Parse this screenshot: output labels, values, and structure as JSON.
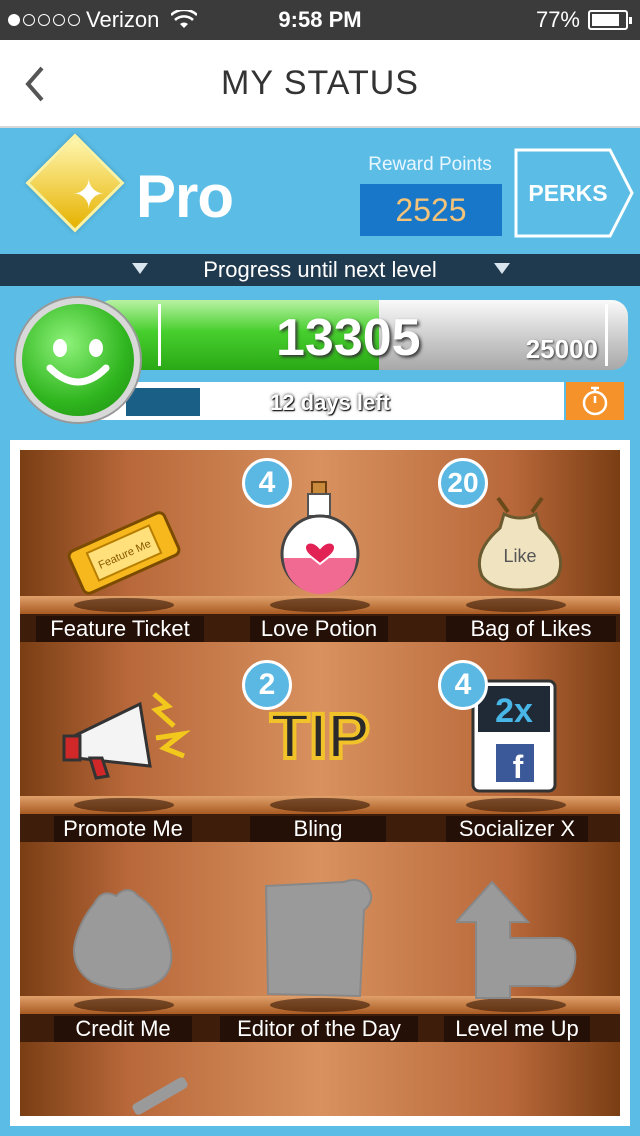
{
  "status_bar": {
    "carrier": "Verizon",
    "time": "9:58 PM",
    "battery": "77%"
  },
  "nav": {
    "back_label": "‹",
    "title": "MY STATUS"
  },
  "level": {
    "name": "Pro",
    "reward_points_label": "Reward Points",
    "reward_points": "2525",
    "perks_label": "PERKS"
  },
  "progress": {
    "label": "Progress until next level",
    "current": "13305",
    "max": "25000",
    "fraction": 0.532,
    "days_left": "12 days left"
  },
  "colors": {
    "background": "#5bbde6",
    "accent_blue": "#1877c9",
    "timer_orange": "#f5922a",
    "progress_green": "#47cf2e"
  },
  "shelf": {
    "items": [
      {
        "label": "Feature Ticket",
        "badge": "",
        "icon": "ticket-icon",
        "ticket_text": "Feature Me"
      },
      {
        "label": "Love Potion",
        "badge": "4",
        "icon": "potion-icon"
      },
      {
        "label": "Bag of Likes",
        "badge": "20",
        "icon": "bag-icon",
        "bag_text": "Like"
      },
      {
        "label": "Promote Me",
        "badge": "",
        "icon": "megaphone-icon"
      },
      {
        "label": "Bling",
        "badge": "2",
        "icon": "tip-bling-icon",
        "tip_text": "TIP"
      },
      {
        "label": "Socializer X",
        "badge": "4",
        "icon": "socializer-icon",
        "multiplier": "2x",
        "fb": "f"
      },
      {
        "label": "Credit Me",
        "badge": "",
        "icon": "locked-purse-icon"
      },
      {
        "label": "Editor of the Day",
        "badge": "",
        "icon": "locked-paper-icon"
      },
      {
        "label": "Level me Up",
        "badge": "",
        "icon": "locked-arrow-icon"
      }
    ]
  }
}
